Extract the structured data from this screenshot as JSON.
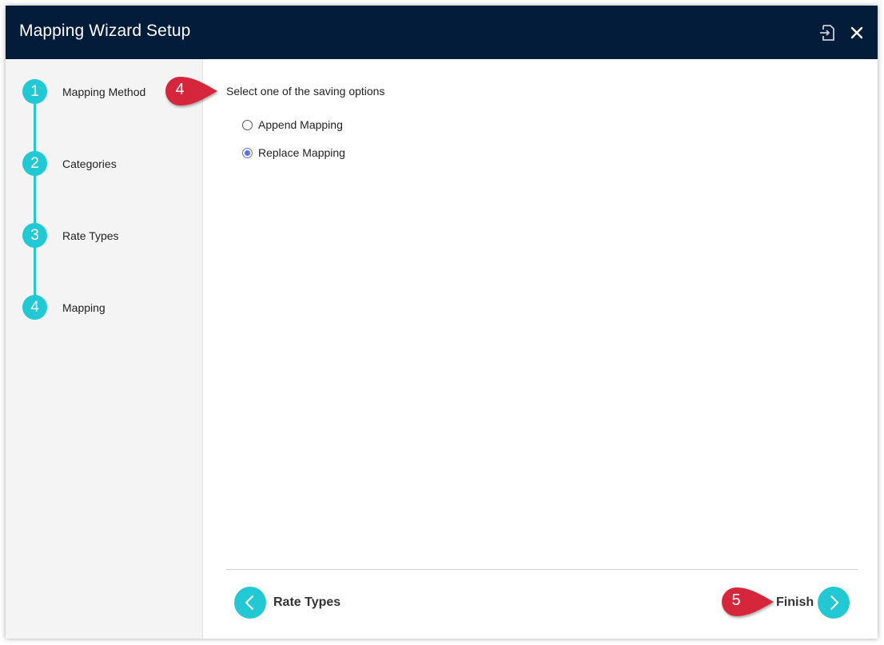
{
  "header": {
    "title": "Mapping Wizard Setup",
    "icons": [
      "export-icon",
      "close-icon"
    ]
  },
  "steps": [
    {
      "number": "1",
      "label": "Mapping Method"
    },
    {
      "number": "2",
      "label": "Categories"
    },
    {
      "number": "3",
      "label": "Rate Types"
    },
    {
      "number": "4",
      "label": "Mapping"
    }
  ],
  "main": {
    "prompt": "Select one of the saving options",
    "options": [
      {
        "label": "Append Mapping",
        "selected": false
      },
      {
        "label": "Replace Mapping",
        "selected": true
      }
    ]
  },
  "footer": {
    "back_label": "Rate Types",
    "finish_label": "Finish"
  },
  "callouts": {
    "first": "4",
    "second": "5",
    "color": "#d6263b"
  },
  "colors": {
    "header_bg": "#031c3a",
    "accent": "#22c9d4",
    "radio_selected": "#5a6fe0"
  }
}
